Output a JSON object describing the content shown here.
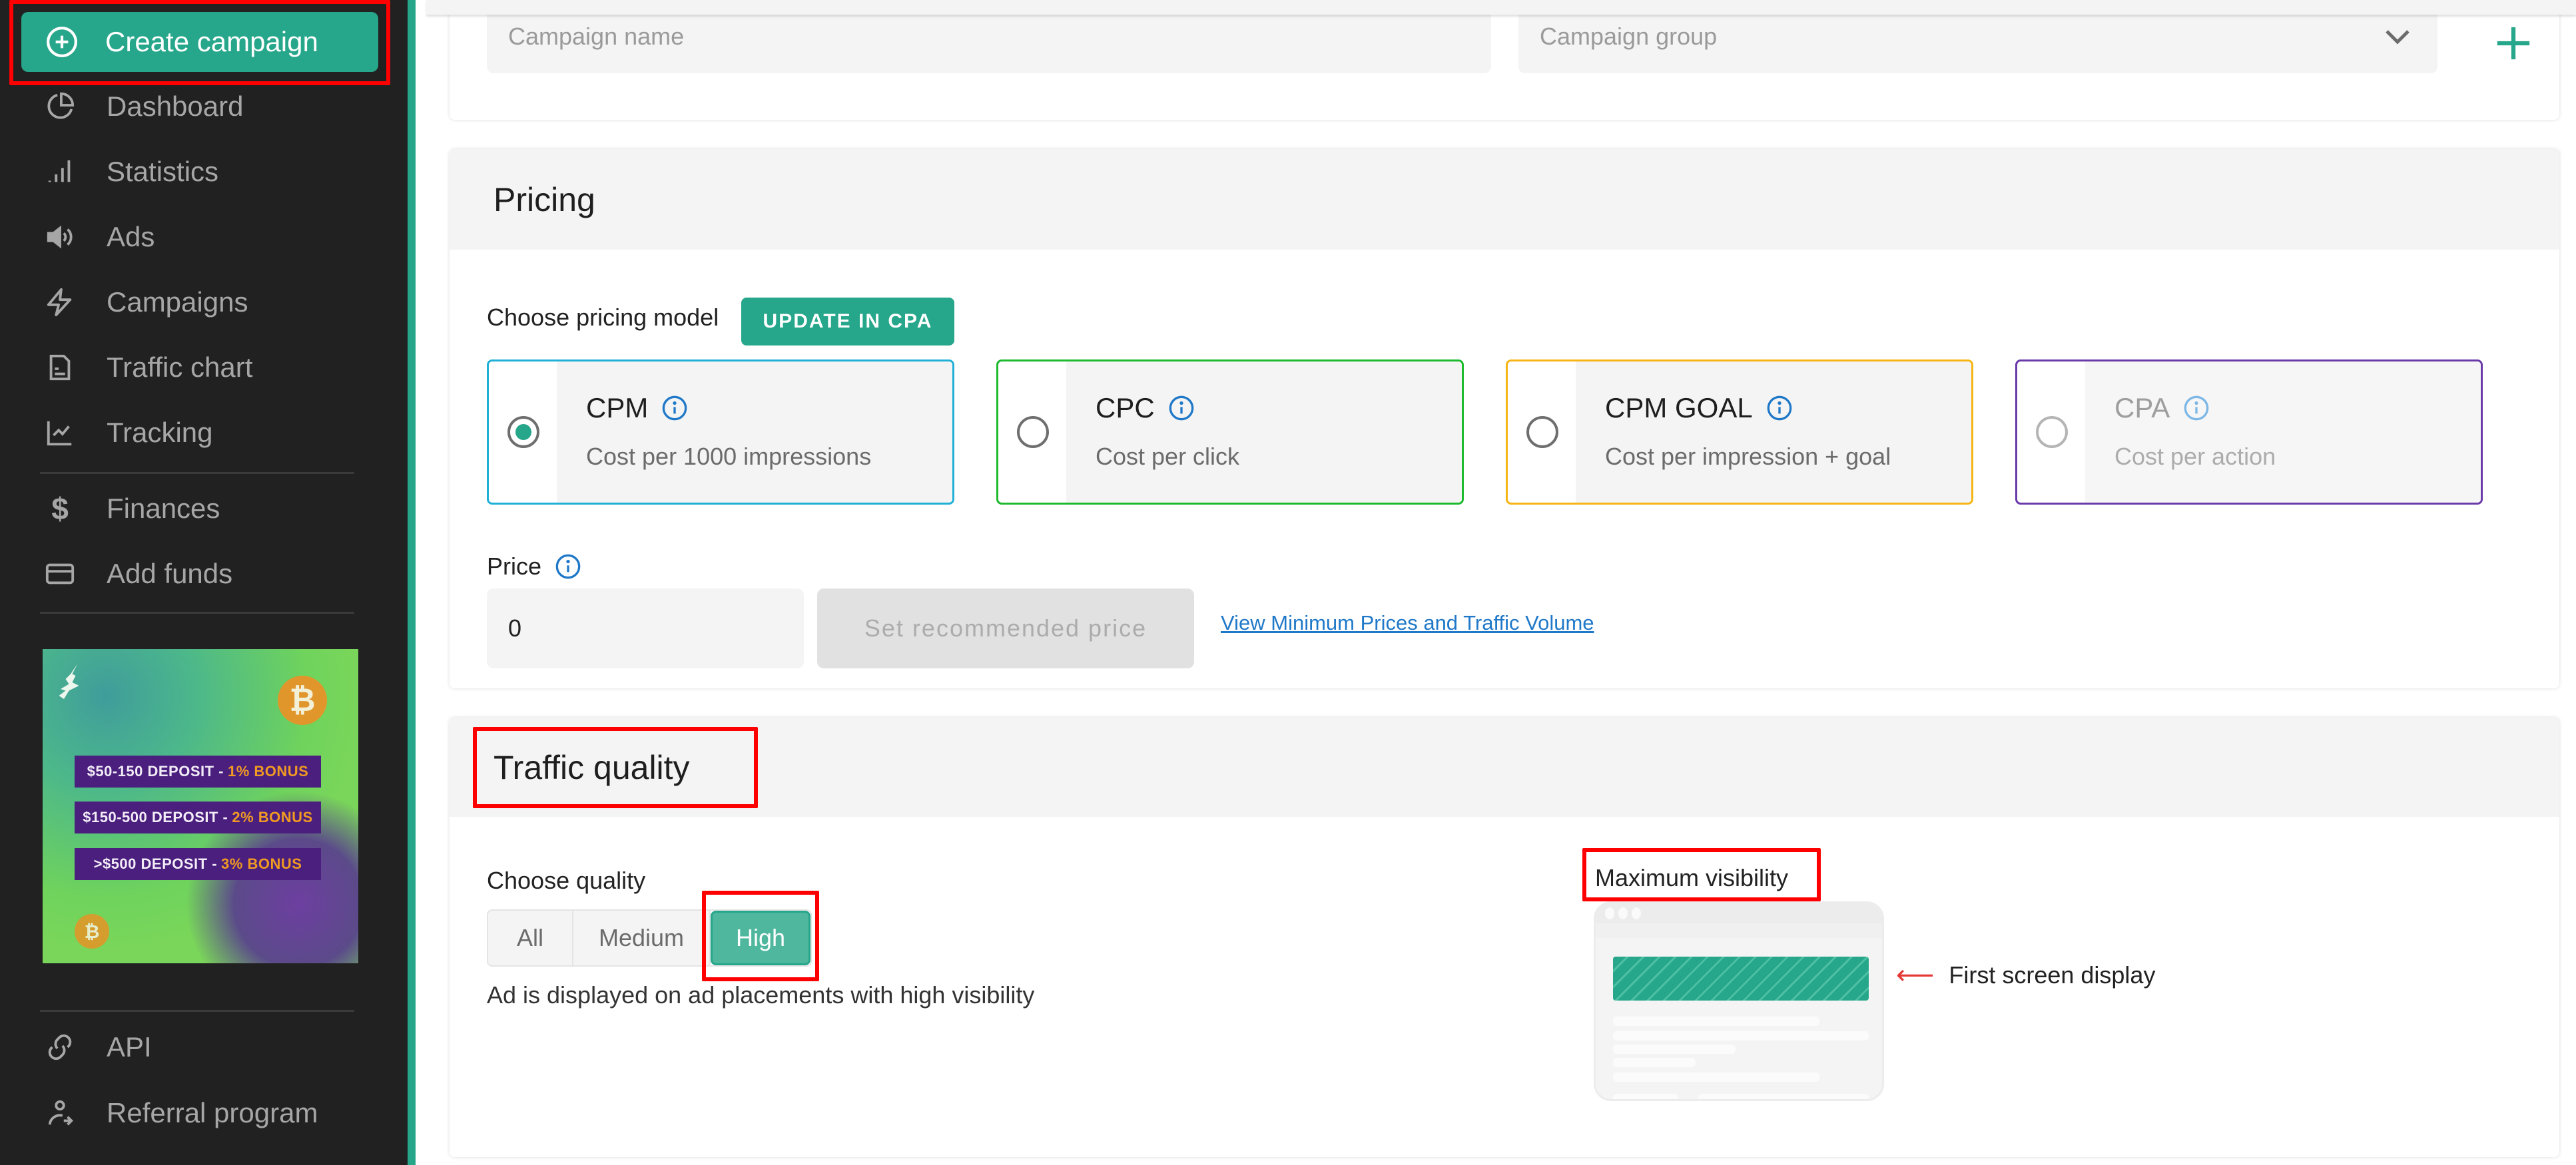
{
  "sidebar": {
    "create_button": {
      "label": "Create campaign",
      "icon": "plus-circle-icon"
    },
    "items": [
      {
        "label": "Dashboard",
        "icon": "pie-chart-icon"
      },
      {
        "label": "Statistics",
        "icon": "signal-bars-icon"
      },
      {
        "label": "Ads",
        "icon": "speaker-icon"
      },
      {
        "label": "Campaigns",
        "icon": "lightning-icon"
      },
      {
        "label": "Traffic chart",
        "icon": "document-icon"
      },
      {
        "label": "Tracking",
        "icon": "line-chart-icon"
      },
      {
        "label": "Finances",
        "icon": "dollar-icon"
      },
      {
        "label": "Add funds",
        "icon": "credit-card-icon"
      },
      {
        "label": "API",
        "icon": "link-icon"
      },
      {
        "label": "Referral program",
        "icon": "user-referral-icon"
      }
    ],
    "promo": {
      "rows": [
        {
          "main": "$50-150 DEPOSIT -",
          "bonus": "1% BONUS"
        },
        {
          "main": "$150-500 DEPOSIT -",
          "bonus": "2% BONUS"
        },
        {
          "main": ">$500 DEPOSIT -",
          "bonus": "3% BONUS"
        }
      ],
      "coin_symbol": "₿"
    }
  },
  "campaign": {
    "name_placeholder": "Campaign name",
    "group_placeholder": "Campaign group"
  },
  "pricing": {
    "title": "Pricing",
    "choose_label": "Choose pricing model",
    "update_button": "UPDATE IN CPA",
    "models": [
      {
        "title": "CPM",
        "desc": "Cost per 1000 impressions",
        "selected": true,
        "disabled": false,
        "border_color": "#1fb0d6"
      },
      {
        "title": "CPC",
        "desc": "Cost per click",
        "selected": false,
        "disabled": false,
        "border_color": "#1dba2e"
      },
      {
        "title": "CPM GOAL",
        "desc": "Cost per impression + goal",
        "selected": false,
        "disabled": false,
        "border_color": "#f6b515"
      },
      {
        "title": "CPA",
        "desc": "Cost per action",
        "selected": false,
        "disabled": true,
        "border_color": "#6a3aa8"
      }
    ],
    "price_label": "Price",
    "price_value": "0",
    "recommend_button": "Set recommended price",
    "min_prices_link": "View Minimum Prices and Traffic Volume"
  },
  "traffic_quality": {
    "title": "Traffic quality",
    "choose_label": "Choose quality",
    "options": [
      "All",
      "Medium",
      "High"
    ],
    "selected": "High",
    "help_text": "Ad is displayed on ad placements with high visibility",
    "visibility_label": "Maximum visibility",
    "first_screen_label": "First screen display",
    "arrow": "⟵"
  },
  "colors": {
    "accent": "#26a68a",
    "sidebar_bg": "#212121",
    "annotation": "#ff0000",
    "link": "#1f78c8"
  }
}
